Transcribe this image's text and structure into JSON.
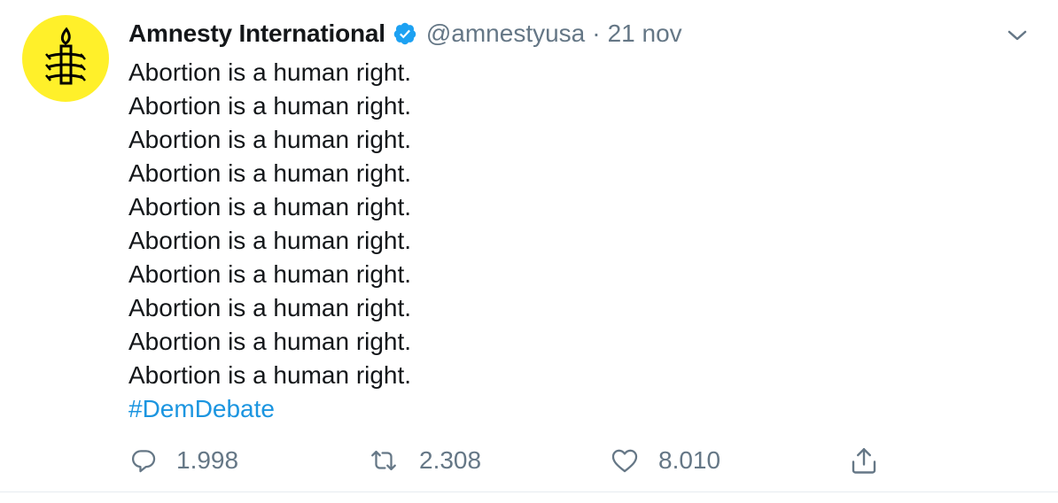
{
  "tweet": {
    "author_name": "Amnesty International",
    "handle": "@amnestyusa",
    "separator": "·",
    "date": "21 nov",
    "lines": [
      "Abortion is a human right.",
      "Abortion is a human right.",
      "Abortion is a human right.",
      "Abortion is a human right.",
      "Abortion is a human right.",
      "Abortion is a human right.",
      "Abortion is a human right.",
      "Abortion is a human right.",
      "Abortion is a human right.",
      "Abortion is a human right."
    ],
    "hashtag": "#DemDebate"
  },
  "actions": {
    "replies": "1.998",
    "retweets": "2.308",
    "likes": "8.010"
  },
  "icons": {
    "avatar": "amnesty-candle-logo",
    "verified": "verified-badge-icon",
    "menu": "chevron-down-icon",
    "reply": "reply-icon",
    "retweet": "retweet-icon",
    "like": "heart-icon",
    "share": "share-icon"
  },
  "colors": {
    "avatar_bg": "#fff02a",
    "verified": "#1da1f2",
    "hashtag": "#1b95e0",
    "secondary_text": "#657786",
    "primary_text": "#14171a"
  }
}
